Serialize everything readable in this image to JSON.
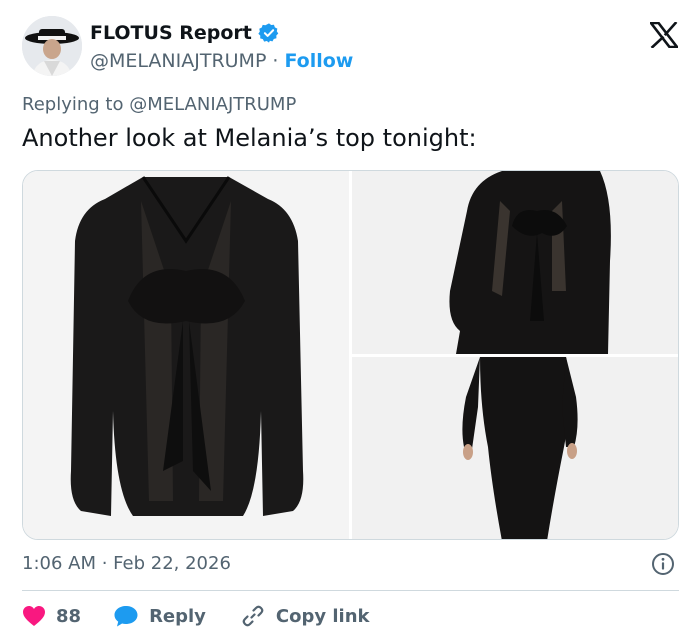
{
  "author": {
    "display_name": "FLOTUS Report",
    "handle": "@MELANIAJTRUMP",
    "separator": "·",
    "follow_label": "Follow",
    "verified_color": "#1d9bf0"
  },
  "reply_to_text": "Replying to @MELANIAJTRUMP",
  "tweet_text": "Another look at Melania’s top tonight:",
  "timestamp": "1:06 AM · Feb 22, 2026",
  "actions": {
    "likes_count": "88",
    "reply_label": "Reply",
    "copy_link_label": "Copy link"
  },
  "colors": {
    "accent": "#1d9bf0",
    "heart": "#f91880",
    "muted": "#536471",
    "divider": "#cfd9de"
  },
  "icons": [
    "verified-badge-icon",
    "x-logo-icon",
    "info-icon",
    "heart-icon",
    "reply-bubble-icon",
    "link-icon"
  ]
}
